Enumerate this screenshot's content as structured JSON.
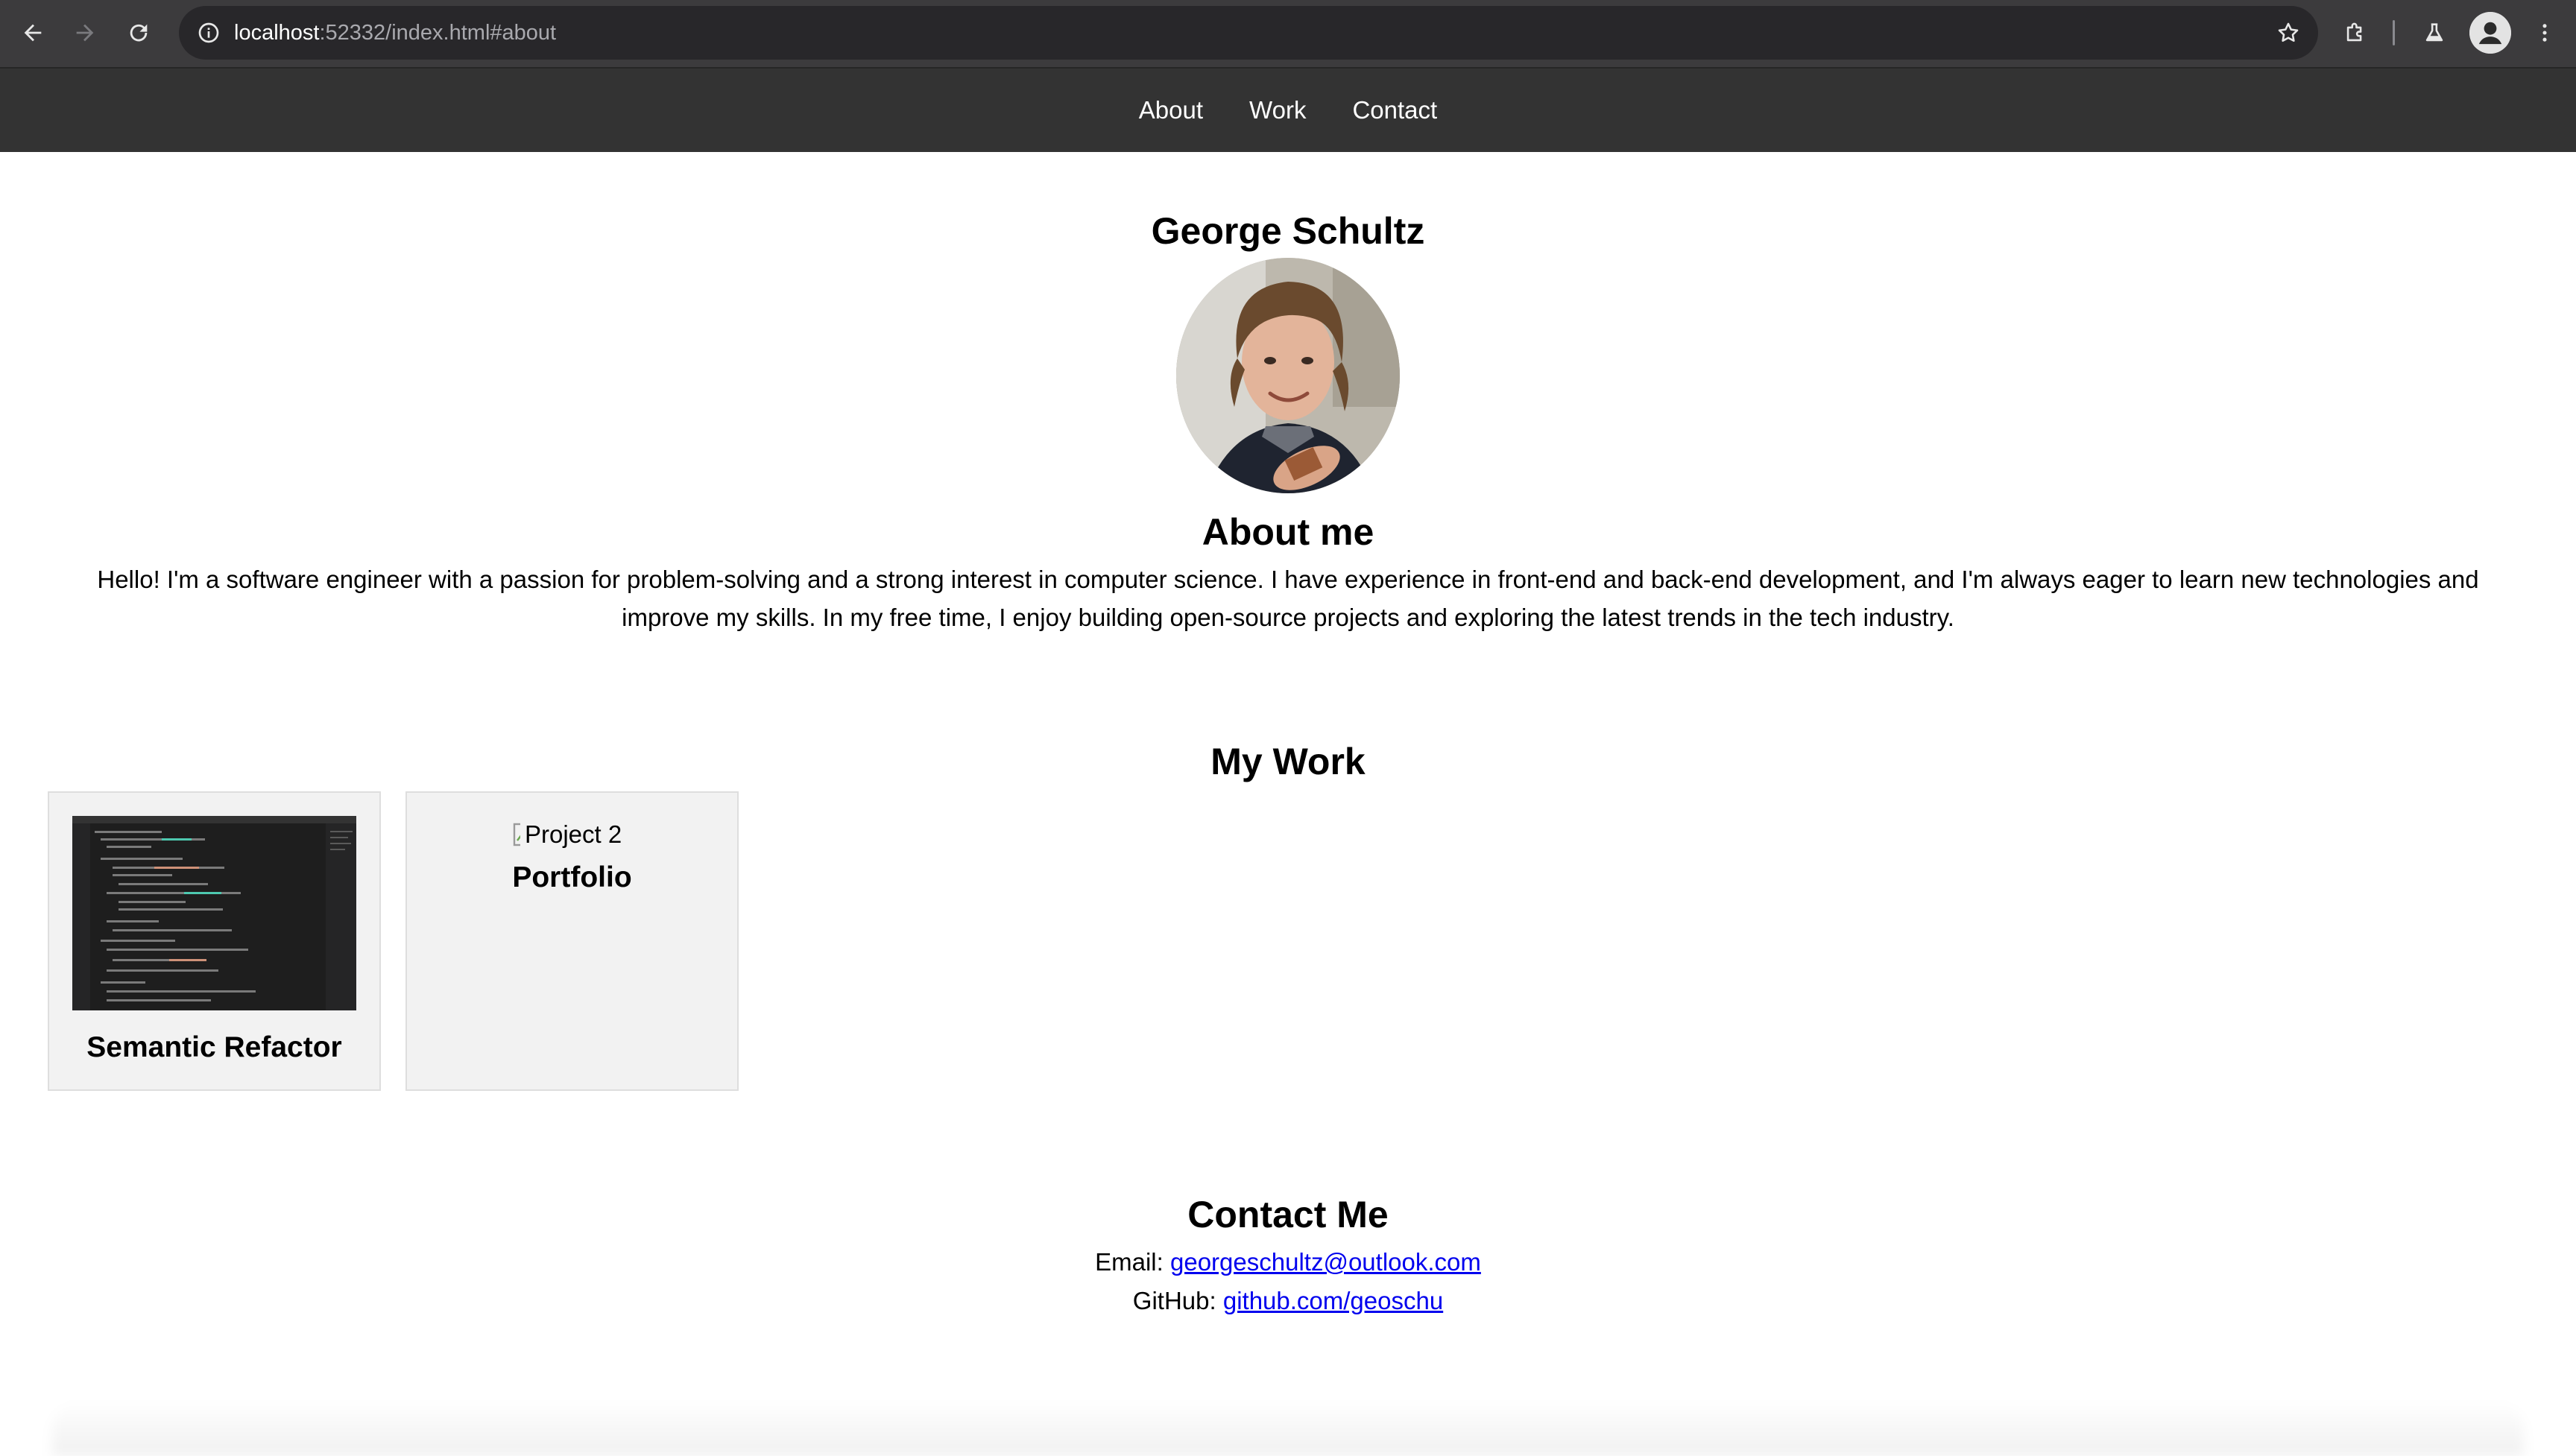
{
  "browser": {
    "url_host": "localhost",
    "url_rest": ":52332/index.html#about"
  },
  "nav": {
    "items": [
      {
        "label": "About"
      },
      {
        "label": "Work"
      },
      {
        "label": "Contact"
      }
    ]
  },
  "profile": {
    "name": "George Schultz",
    "photo_icon": "profile-photo"
  },
  "about": {
    "heading": "About me",
    "text": "Hello! I'm a software engineer with a passion for problem-solving and a strong interest in computer science. I have experience in front-end and back-end development, and I'm always eager to learn new technologies and improve my skills. In my free time, I enjoy building open-source projects and exploring the latest trends in the tech industry."
  },
  "work": {
    "heading": "My Work",
    "projects": [
      {
        "title": "Semantic Refactor",
        "image": "code-editor-screenshot"
      },
      {
        "title": "Portfolio",
        "image_alt": "Project 2"
      }
    ]
  },
  "contact": {
    "heading": "Contact Me",
    "email_label": "Email:",
    "email": "georgeschultz@outlook.com",
    "github_label": "GitHub:",
    "github": "github.com/geoschu"
  },
  "colors": {
    "chrome_bg": "#3c3b3d",
    "nav_bg": "#333333",
    "card_bg": "#f2f2f2",
    "link": "#0000ee"
  }
}
